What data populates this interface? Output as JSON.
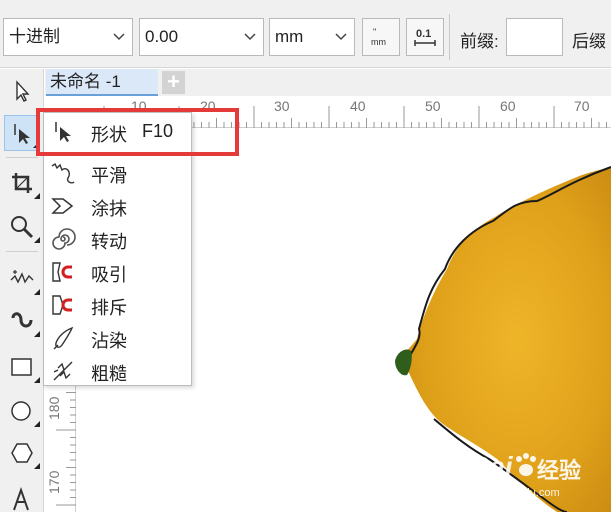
{
  "property_bar": {
    "units_type": "十进制",
    "value_field": "0.00",
    "unit": "mm",
    "prefix_label": "前缀:",
    "suffix_label": "后缀"
  },
  "document": {
    "tab_title": "未命名 -1",
    "add_tab": "+"
  },
  "ruler": {
    "horizontal": [
      "10",
      "20",
      "30",
      "40",
      "50",
      "60",
      "70"
    ],
    "vertical": [
      "180",
      "170"
    ]
  },
  "toolbox": {
    "tools": [
      "pick-tool",
      "shape-tool",
      "crop-tool",
      "zoom-tool",
      "freehand-tool",
      "artistic-media-tool",
      "rectangle-tool",
      "ellipse-tool",
      "polygon-tool",
      "text-tool"
    ]
  },
  "flyout": {
    "items": [
      {
        "label": "形状",
        "shortcut": "F10",
        "icon": "shape-icon"
      },
      {
        "label": "平滑",
        "icon": "smooth-icon"
      },
      {
        "label": "涂抹",
        "icon": "smear-icon"
      },
      {
        "label": "转动",
        "icon": "twirl-icon"
      },
      {
        "label": "吸引",
        "icon": "attract-icon"
      },
      {
        "label": "排斥",
        "icon": "repel-icon"
      },
      {
        "label": "沾染",
        "icon": "smudge-icon"
      },
      {
        "label": "粗糙",
        "icon": "roughen-icon"
      }
    ]
  },
  "watermark": {
    "brand": "Bai",
    "name": "经验",
    "url": "jingyan.baidu.com"
  },
  "colors": {
    "highlight": "#e53a3a",
    "lemon": "#e3a019",
    "tab_active": "#dbe8f7"
  }
}
